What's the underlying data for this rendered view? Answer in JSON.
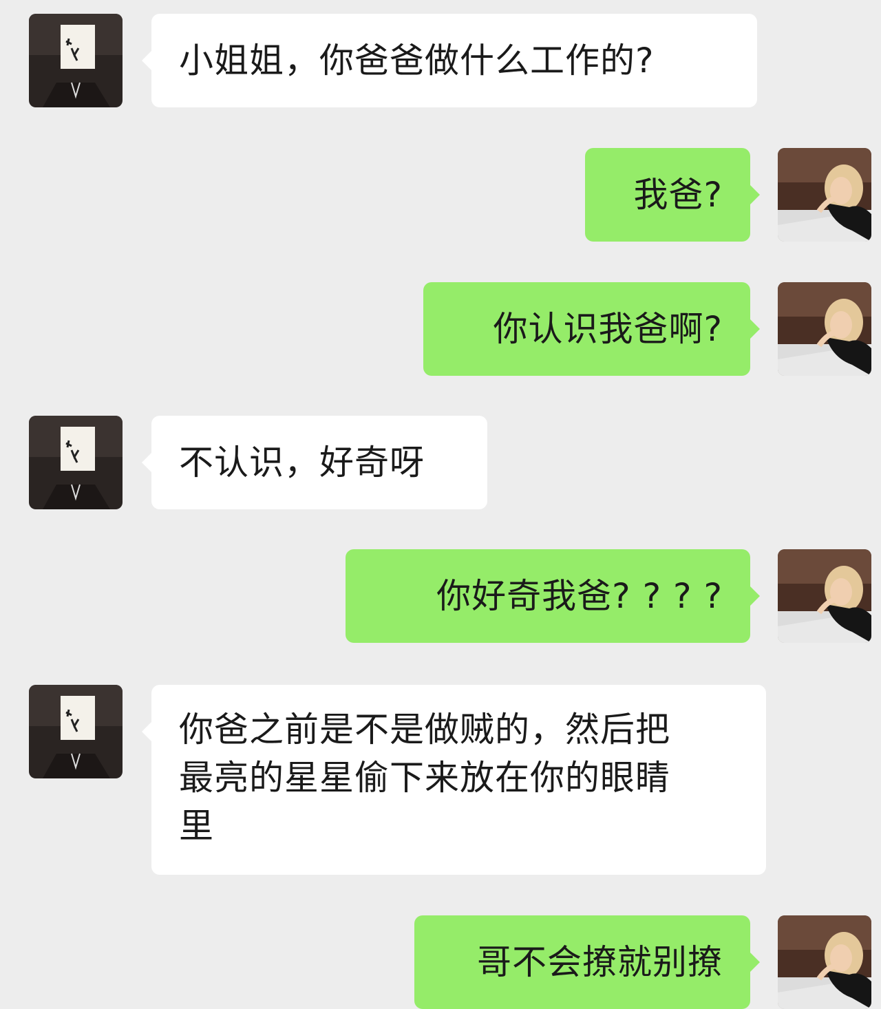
{
  "colors": {
    "background": "#ededed",
    "incoming_bubble": "#ffffff",
    "outgoing_bubble": "#95ec69"
  },
  "avatars": {
    "incoming": "paper-bag-head-avatar",
    "outgoing": "woman-photo-avatar"
  },
  "messages": [
    {
      "side": "incoming",
      "text": "小姐姐，你爸爸做什么工作的?"
    },
    {
      "side": "outgoing",
      "text": "我爸?"
    },
    {
      "side": "outgoing",
      "text": "你认识我爸啊?"
    },
    {
      "side": "incoming",
      "text": "不认识，好奇呀"
    },
    {
      "side": "outgoing",
      "text": "你好奇我爸? ? ? ?"
    },
    {
      "side": "incoming",
      "lines": [
        "你爸之前是不是做贼的，然后把",
        "最亮的星星偷下来放在你的眼睛",
        "里"
      ]
    },
    {
      "side": "outgoing",
      "text": "哥不会撩就别撩"
    }
  ]
}
